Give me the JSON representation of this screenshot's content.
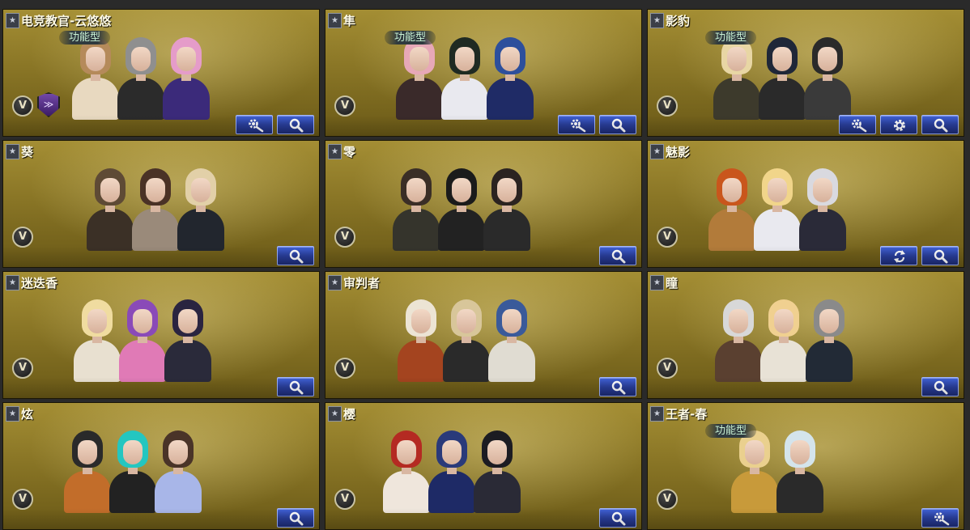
{
  "cards": [
    {
      "name": "电竞教官-云悠悠",
      "tag": "功能型",
      "buttons": [
        "wrench-gear-icon",
        "magnifier-icon"
      ],
      "shield": true,
      "chars": [
        {
          "hair": "#b58a5a",
          "body": "#e8d9c0"
        },
        {
          "hair": "#8f8f8f",
          "body": "#2b2b2b"
        },
        {
          "hair": "#e59cc9",
          "body": "#3b2a7a"
        }
      ]
    },
    {
      "name": "隼",
      "tag": "功能型",
      "buttons": [
        "wrench-gear-icon",
        "magnifier-icon"
      ],
      "shield": false,
      "chars": [
        {
          "hair": "#e7a8b7",
          "body": "#3a2a2a"
        },
        {
          "hair": "#1f2a22",
          "body": "#e9e9ef"
        },
        {
          "hair": "#2d4f9c",
          "body": "#1f2b66"
        }
      ]
    },
    {
      "name": "影豹",
      "tag": "功能型",
      "buttons": [
        "wrench-gear-icon",
        "gear-icon",
        "magnifier-icon"
      ],
      "shield": false,
      "chars": [
        {
          "hair": "#e8d6a4",
          "body": "#3d3a2c"
        },
        {
          "hair": "#1f2738",
          "body": "#2a2a2a"
        },
        {
          "hair": "#2a2a2a",
          "body": "#3a3a3a"
        }
      ]
    },
    {
      "name": "葵",
      "tag": "",
      "buttons": [
        "magnifier-icon"
      ],
      "shield": false,
      "chars": [
        {
          "hair": "#5e4a35",
          "body": "#3b3026"
        },
        {
          "hair": "#4a3226",
          "body": "#9a8a7a"
        },
        {
          "hair": "#e2d0a8",
          "body": "#22262e"
        }
      ]
    },
    {
      "name": "零",
      "tag": "",
      "buttons": [
        "magnifier-icon"
      ],
      "shield": false,
      "chars": [
        {
          "hair": "#3a2e26",
          "body": "#35342c"
        },
        {
          "hair": "#1b1b1b",
          "body": "#222"
        },
        {
          "hair": "#2b2320",
          "body": "#2a2a2a"
        }
      ]
    },
    {
      "name": "魅影",
      "tag": "",
      "buttons": [
        "refresh-icon",
        "magnifier-icon"
      ],
      "shield": false,
      "chars": [
        {
          "hair": "#c9561c",
          "body": "#b27b3a"
        },
        {
          "hair": "#f1d58a",
          "body": "#e9e9ef"
        },
        {
          "hair": "#d9d9df",
          "body": "#2a2a38"
        }
      ]
    },
    {
      "name": "迷迭香",
      "tag": "",
      "buttons": [
        "magnifier-icon"
      ],
      "shield": false,
      "chars": [
        {
          "hair": "#f0dca0",
          "body": "#e8e0d0"
        },
        {
          "hair": "#8a4ab8",
          "body": "#e07ab6"
        },
        {
          "hair": "#2a2440",
          "body": "#2a2a3a"
        }
      ]
    },
    {
      "name": "审判者",
      "tag": "",
      "buttons": [
        "magnifier-icon"
      ],
      "shield": false,
      "chars": [
        {
          "hair": "#ece4d4",
          "body": "#a4441f"
        },
        {
          "hair": "#d8c69a",
          "body": "#2a2a2a"
        },
        {
          "hair": "#3a5a9a",
          "body": "#e0dcd2"
        }
      ]
    },
    {
      "name": "瞳",
      "tag": "",
      "buttons": [
        "magnifier-icon"
      ],
      "shield": false,
      "chars": [
        {
          "hair": "#d8d8d8",
          "body": "#5a4030"
        },
        {
          "hair": "#f0d090",
          "body": "#e8e2d6"
        },
        {
          "hair": "#8a8a8a",
          "body": "#222a36"
        }
      ]
    },
    {
      "name": "炫",
      "tag": "",
      "buttons": [
        "magnifier-icon"
      ],
      "shield": false,
      "chars": [
        {
          "hair": "#2a2a2a",
          "body": "#c26d2a"
        },
        {
          "hair": "#24c6c0",
          "body": "#222"
        },
        {
          "hair": "#4a3428",
          "body": "#a8b6e8"
        }
      ]
    },
    {
      "name": "樱",
      "tag": "",
      "buttons": [
        "magnifier-icon"
      ],
      "shield": false,
      "chars": [
        {
          "hair": "#b42a22",
          "body": "#efe6dc"
        },
        {
          "hair": "#2a3a7a",
          "body": "#1e2a66"
        },
        {
          "hair": "#1c1c22",
          "body": "#2a2a36"
        }
      ]
    },
    {
      "name": "王者-春",
      "tag": "功能型",
      "buttons": [
        "wrench-gear-icon"
      ],
      "shield": false,
      "chars": [
        {
          "hair": "#ead08e",
          "body": "#c89a3a"
        },
        {
          "hair": "#d4e4ec",
          "body": "#2a2a2a"
        }
      ]
    }
  ],
  "badge_letter": "V"
}
